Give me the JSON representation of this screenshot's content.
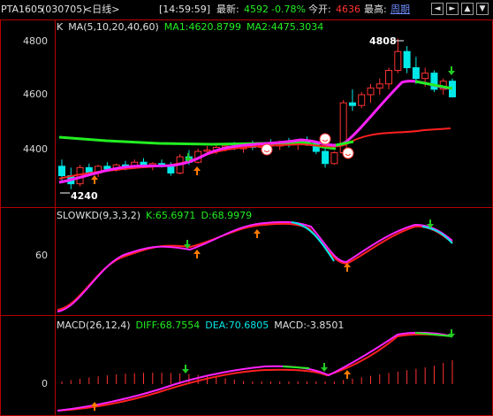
{
  "header": {
    "symbol": "PTA1605",
    "code": "(030705)",
    "period": "<日线>",
    "time": "[14:59:59]",
    "latest_label": "最新:",
    "latest_value": "4592",
    "change_pct": "-0.78%",
    "open_label": "今开:",
    "open_value": "4636",
    "high_label": "最高:",
    "period_link": "周期",
    "nav_buttons": [
      "◄",
      "►",
      "▲",
      "▼"
    ]
  },
  "panels": {
    "price": {
      "label": "K",
      "ma_label": "MA(5,10,20,40,60)",
      "ma1": "MA1:4620.8799",
      "ma2": "MA2:4475.3034",
      "ticks": [
        "4800",
        "4600",
        "4400"
      ],
      "max_label": "4808",
      "min_label": "4240"
    },
    "kd": {
      "label": "SLOWKD(9,3,3,2)",
      "k": "K:65.6971",
      "d": "D:68.9979",
      "ticks": [
        "60"
      ]
    },
    "macd": {
      "label": "MACD(26,12,4)",
      "diff": "DIFF:68.7554",
      "dea": "DEA:70.6805",
      "macd": "MACD:-3.8501",
      "ticks": [
        "0"
      ]
    }
  },
  "colors": {
    "up": "#ff3232",
    "down": "#00e8e8",
    "ma_green": "#22ee22",
    "ma_magenta": "#ff22ff",
    "ma_red": "#ff2020",
    "border": "#b40000",
    "yellow": "#ffff00",
    "white": "#ffffff"
  }
}
